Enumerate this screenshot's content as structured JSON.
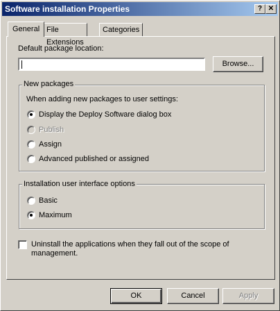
{
  "window": {
    "title": "Software installation Properties",
    "help_label": "?",
    "close_label": "✕"
  },
  "tabs": [
    {
      "label": "General"
    },
    {
      "label": "File Extensions"
    },
    {
      "label": "Categories"
    }
  ],
  "general": {
    "location_label": "Default package location:",
    "location_value": "",
    "browse_label": "Browse...",
    "new_packages": {
      "title": "New packages",
      "prompt": "When adding new packages to user settings:",
      "options": [
        {
          "label": "Display the Deploy Software dialog box"
        },
        {
          "label": "Publish"
        },
        {
          "label": "Assign"
        },
        {
          "label": "Advanced published or assigned"
        }
      ]
    },
    "ui_options": {
      "title": "Installation user interface options",
      "options": [
        {
          "label": "Basic"
        },
        {
          "label": "Maximum"
        }
      ]
    },
    "uninstall_line1": "Uninstall the applications when they fall out of the scope of",
    "uninstall_line2": "management."
  },
  "footer": {
    "ok_label": "OK",
    "cancel_label": "Cancel",
    "apply_label": "Apply"
  }
}
